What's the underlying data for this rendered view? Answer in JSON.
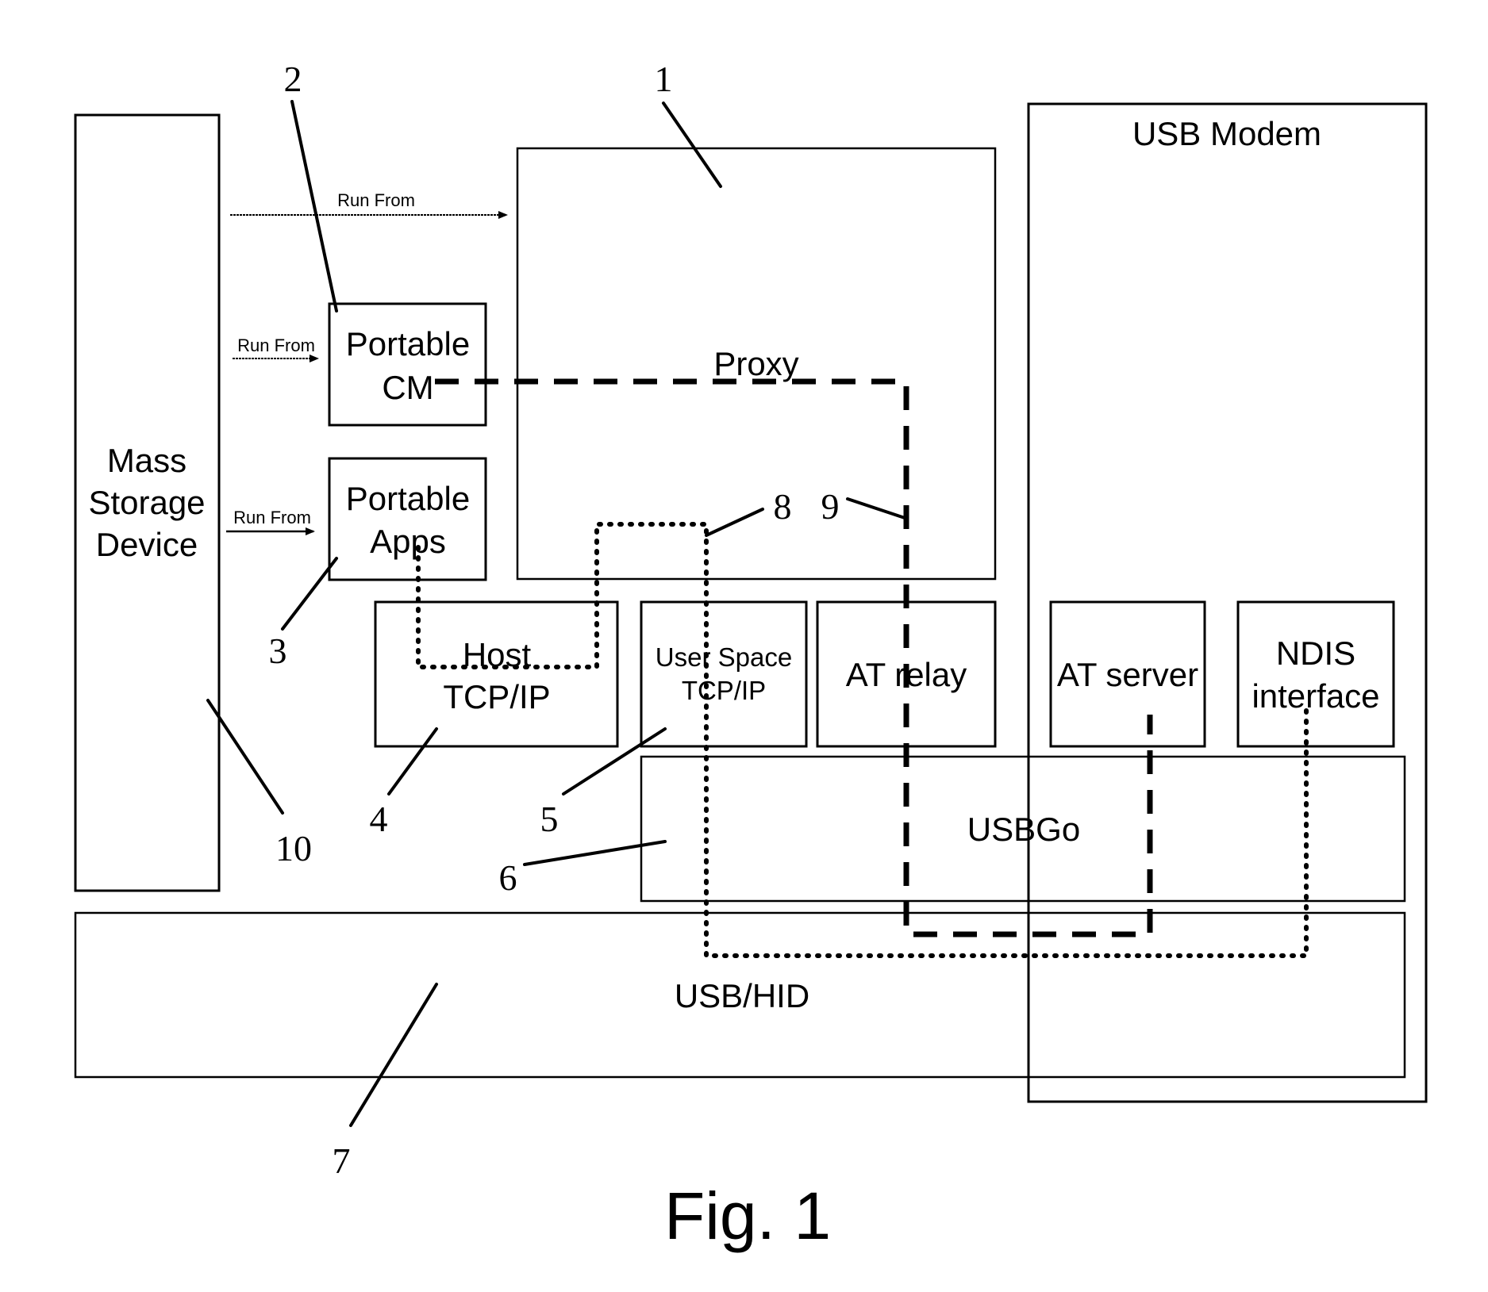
{
  "figure": {
    "caption": "Fig. 1"
  },
  "blocks": {
    "mass_storage": [
      "Mass",
      "Storage",
      "Device"
    ],
    "portable_cm": [
      "Portable",
      "CM"
    ],
    "portable_apps": [
      "Portable",
      "Apps"
    ],
    "proxy": "Proxy",
    "usb_modem": "USB Modem",
    "host_tcpip": [
      "Host",
      "TCP/IP"
    ],
    "user_space_tcpip": [
      "User Space",
      "TCP/IP"
    ],
    "at_relay": "AT relay",
    "at_server": "AT server",
    "ndis_interface": [
      "NDIS",
      "interface"
    ],
    "usbgo": "USBGo",
    "usb_hid": "USB/HID"
  },
  "arrows": {
    "run_from_proxy": "Run From",
    "run_from_cm": "Run From",
    "run_from_apps": "Run From"
  },
  "reference_numerals": {
    "proxy": "1",
    "portable_cm": "2",
    "portable_apps": "3",
    "host_tcpip": "4",
    "user_space_tcpip": "5",
    "usbgo": "6",
    "usb_hid": "7",
    "data_path_dotted": "8",
    "control_path_dashed": "9",
    "mass_storage": "10"
  },
  "paths": {
    "dotted_path_8": "Portable Apps → Host TCP/IP → User Space TCP/IP → USB/HID → NDIS interface",
    "dashed_path_9": "Portable CM → Proxy → AT relay → USB/HID → AT server"
  }
}
